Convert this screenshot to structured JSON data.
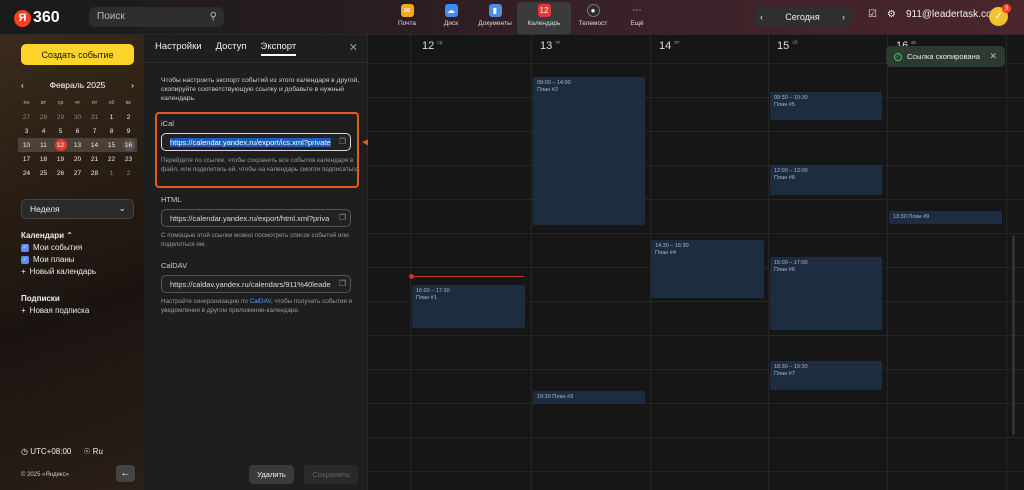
{
  "topbar": {
    "logo_text": "360",
    "logo_letter": "Я",
    "search_placeholder": "Поиск",
    "apps": [
      {
        "label": "Почта",
        "icon": "mail-icon",
        "color": "#f5a623"
      },
      {
        "label": "Диск",
        "icon": "disk-icon",
        "color": "#3d8bfd"
      },
      {
        "label": "Документы",
        "icon": "documents-icon",
        "color": "#4a90e2"
      },
      {
        "label": "Календарь",
        "icon": "calendar-icon",
        "color": "#e53935",
        "badge": "12",
        "active": true
      },
      {
        "label": "Телемост",
        "icon": "telemost-icon",
        "color": "#2b2b2b"
      },
      {
        "label": "Ещё",
        "icon": "grid-icon",
        "color": "#555"
      }
    ],
    "today_label": "Сегодня",
    "user_email": "911@leadertask.com",
    "avatar_badge": "3"
  },
  "sidebar": {
    "create_button": "Создать событие",
    "month_label": "Февраль 2025",
    "weekdays": [
      "пн",
      "вт",
      "ср",
      "чт",
      "пт",
      "сб",
      "вс"
    ],
    "weeks": [
      [
        "27",
        "28",
        "29",
        "30",
        "31",
        "1",
        "2"
      ],
      [
        "3",
        "4",
        "5",
        "6",
        "7",
        "8",
        "9"
      ],
      [
        "10",
        "11",
        "12",
        "13",
        "14",
        "15",
        "16"
      ],
      [
        "17",
        "18",
        "19",
        "20",
        "21",
        "22",
        "23"
      ],
      [
        "24",
        "25",
        "26",
        "27",
        "28",
        "1",
        "2"
      ]
    ],
    "view_select": "Неделя",
    "calendars_header": "Календари",
    "calendars": [
      "Мои события",
      "Мои планы"
    ],
    "new_calendar": "Новый календарь",
    "subscriptions_header": "Подписки",
    "new_subscription": "Новая подписка",
    "timezone": "UTC+08:00",
    "language": "Ru",
    "copyright": "© 2025 «Яндекс»"
  },
  "panel": {
    "tabs": [
      "Настройки",
      "Доступ",
      "Экспорт"
    ],
    "active_tab": "Экспорт",
    "intro": "Чтобы настроить экспорт событий из этого календаря в другой, скопируйте соответствующую ссылку и добавьте в нужный календарь.",
    "ical": {
      "label": "iCal",
      "url": "https://calendar.yandex.ru/export/ics.xml?private",
      "hint": "Перейдите по ссылке, чтобы сохранить все события календаря в файл, или поделитесь ей, чтобы на календарь смогли подписаться."
    },
    "html": {
      "label": "HTML",
      "url": "https://calendar.yandex.ru/export/html.xml?priva",
      "hint": "С помощью этой ссылки можно посмотреть список событий или поделиться им."
    },
    "caldav": {
      "label": "CalDAV",
      "url": "https://caldav.yandex.ru/calendars/911%40leade",
      "hint_before": "Настройте синхронизацию по ",
      "hint_link": "CalDAV",
      "hint_after": ", чтобы получать события и уведомления в другом приложении-календаре."
    },
    "delete_button": "Удалить",
    "save_button": "Сохранить"
  },
  "grid": {
    "days": [
      {
        "num": "12",
        "wd": "ср"
      },
      {
        "num": "13",
        "wd": "чт"
      },
      {
        "num": "14",
        "wd": "пт"
      },
      {
        "num": "15",
        "wd": "сб"
      },
      {
        "num": "16",
        "wd": "вс"
      }
    ],
    "events": [
      {
        "time": "09:00 – 14:00",
        "title": "План #2"
      },
      {
        "time": "09:30 – 10:30",
        "title": "План #5"
      },
      {
        "time": "12:00 – 13:00",
        "title": "План #8"
      },
      {
        "time": "13:30",
        "title": "План #9"
      },
      {
        "time": "14:30 – 16:30",
        "title": "План #4"
      },
      {
        "time": "15:00 – 17:00",
        "title": "План #6"
      },
      {
        "time": "16:00 – 17:30",
        "title": "План #1"
      },
      {
        "time": "18:30 – 19:30",
        "title": "План #7"
      },
      {
        "time": "19:30",
        "title": "План #3"
      }
    ]
  },
  "toast": {
    "text": "Ссылка скопирована"
  }
}
